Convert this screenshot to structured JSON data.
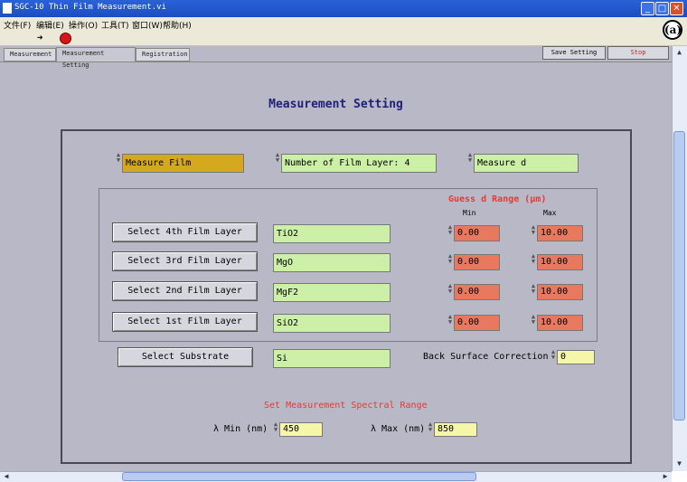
{
  "window": {
    "title": "SGC-10 Thin Film Measurement.vi",
    "minimize": "_",
    "maximize": "□",
    "close": "✕"
  },
  "menu": [
    "文件(F)",
    "编辑(E)",
    "操作(O)",
    "工具(T)",
    "窗口(W)",
    "帮助(H)"
  ],
  "toolbar": {
    "run_icon": "➜",
    "stop_icon": "stop",
    "logo": "(a)"
  },
  "tabs": [
    "Measurement",
    "Measurement Setting",
    "Registration"
  ],
  "top_buttons": {
    "save": "Save Setting",
    "stop": "Stop"
  },
  "heading": "Measurement Setting",
  "selectors": {
    "mode": "Measure Film",
    "layers": "Number of Film Layer: 4",
    "measure": "Measure d"
  },
  "guess_range": {
    "title": "Guess d Range (μm)",
    "min_label": "Min",
    "max_label": "Max"
  },
  "layers": [
    {
      "button": "Select 4th Film Layer",
      "material": "TiO2",
      "min": "0.00",
      "max": "10.00"
    },
    {
      "button": "Select 3rd Film Layer",
      "material": "MgO",
      "min": "0.00",
      "max": "10.00"
    },
    {
      "button": "Select 2nd Film Layer",
      "material": "MgF2",
      "min": "0.00",
      "max": "10.00"
    },
    {
      "button": "Select 1st Film Layer",
      "material": "SiO2",
      "min": "0.00",
      "max": "10.00"
    }
  ],
  "substrate": {
    "button": "Select Substrate",
    "material": "Si"
  },
  "back_surface": {
    "label": "Back Surface Correction",
    "value": "0"
  },
  "spectral": {
    "title": "Set Measurement Spectral Range",
    "min_label": "λ Min (nm)",
    "min_value": "450",
    "max_label": "λ Max (nm)",
    "max_value": "850"
  },
  "colors": {
    "title_bar": "#2a62d8",
    "panel": "#b8b8c6",
    "field_green": "#ccf0a8",
    "field_gold": "#d4a920",
    "field_red": "#e8785e",
    "heading": "#1f1f7a",
    "accent_red": "#e83838"
  }
}
